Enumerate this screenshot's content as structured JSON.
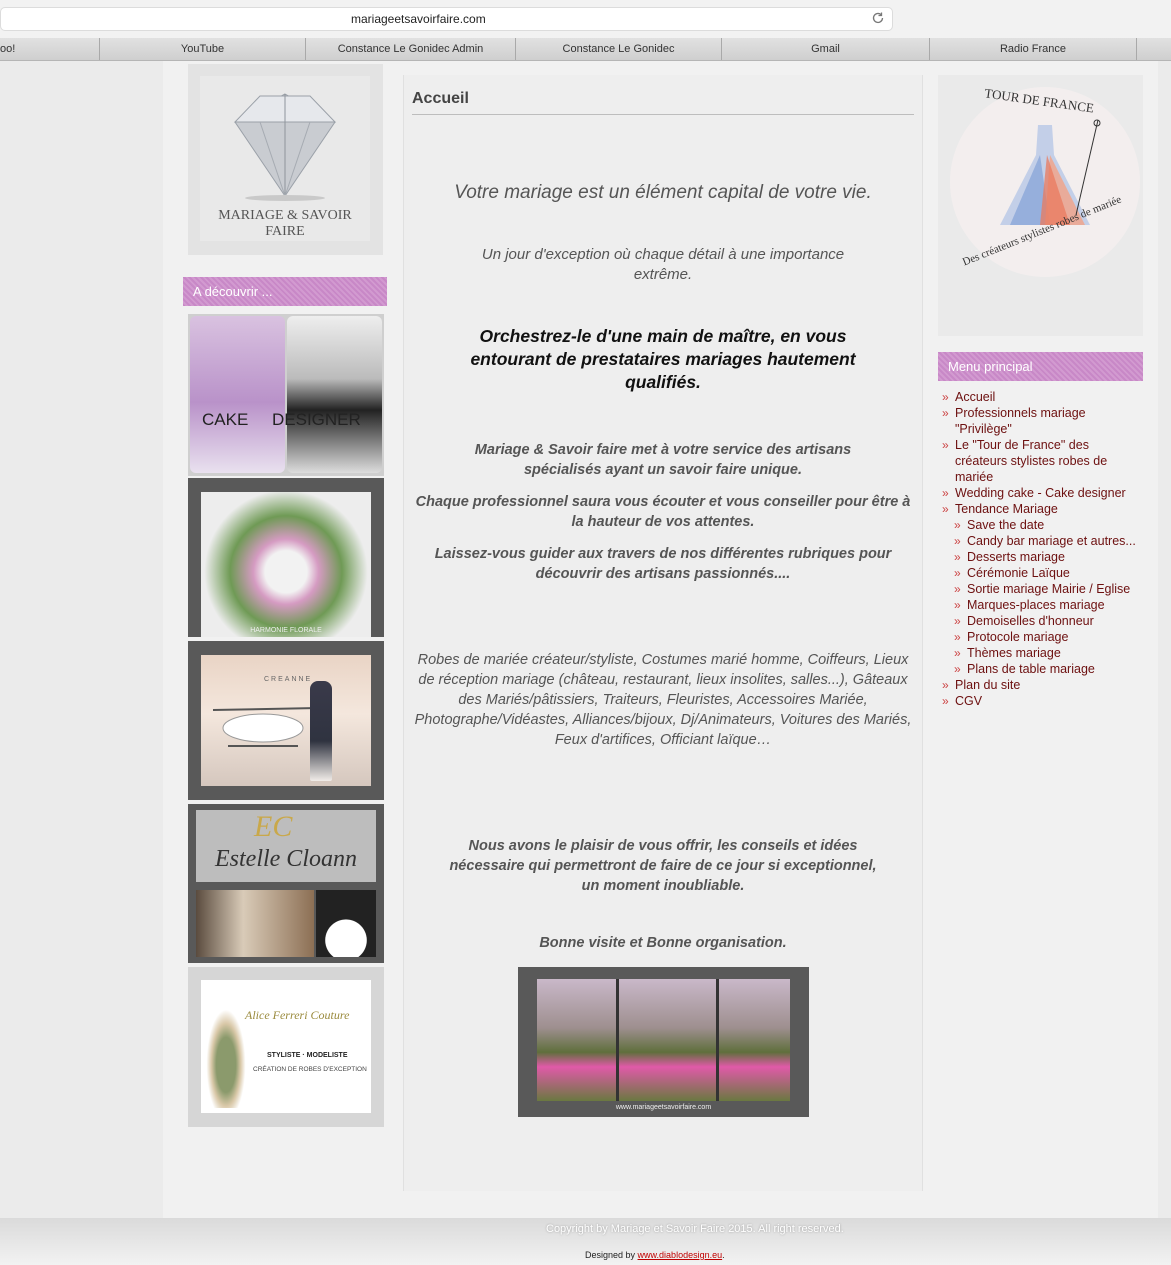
{
  "browser": {
    "url": "mariageetsavoirfaire.com",
    "bookmarks": [
      "oo!",
      "YouTube",
      "Constance Le Gonidec Admin",
      "Constance Le Gonidec",
      "Gmail",
      "Radio France"
    ]
  },
  "logo": {
    "text": "MARIAGE & SAVOIR FAIRE"
  },
  "sidebar_left": {
    "heading": "A découvrir ...",
    "cake_label_1": "CAKE",
    "cake_label_2": "DESIGNER",
    "floral_label": "HARMONIE FLORALE",
    "photo_label": "CREANNE",
    "estelle_monogram": "EC",
    "estelle_name": "Estelle Cloann",
    "alice_name": "Alice Ferreri Couture",
    "alice_sub1": "STYLISTE · MODELISTE",
    "alice_sub2": "CRÉATION DE ROBES D'EXCEPTION"
  },
  "content": {
    "title": "Accueil",
    "p1": "Votre mariage est un élément capital de votre vie.",
    "p2": "Un jour d'exception où chaque détail à une importance extrême.",
    "p3": "Orchestrez-le d'une main de maître, en vous entourant de prestataires mariages hautement qualifiés.",
    "p4": "Mariage & Savoir faire met à votre service des artisans spécialisés ayant un savoir faire unique.",
    "p5": "Chaque professionnel saura vous écouter et vous conseiller pour être à la hauteur de vos attentes.",
    "p6": "Laissez-vous guider aux travers de nos différentes rubriques pour découvrir des artisans passionnés....",
    "p7": "Robes de mariée créateur/styliste, Costumes marié homme, Coiffeurs, Lieux de réception mariage (château, restaurant, lieux insolites, salles...), Gâteaux des Mariés/pâtissiers, Traiteurs, Fleuristes, Accessoires Mariée, Photographe/Vidéastes, Alliances/bijoux, Dj/Animateurs, Voitures des Mariés, Feux d'artifices, Officiant laïque…",
    "p8": "Nous avons le plaisir de vous offrir, les conseils et idées nécessaire qui permettront de faire de ce jour si exceptionnel, un moment inoubliable.",
    "p9": "Bonne visite et Bonne organisation.",
    "banner_url": "www.mariageetsavoirfaire.com"
  },
  "tour_de_france": {
    "title": "TOUR DE FRANCE",
    "subtitle": "Des créateurs stylistes robes de mariée"
  },
  "menu": {
    "heading": "Menu principal",
    "items": [
      {
        "label": "Accueil",
        "sub": false
      },
      {
        "label": "Professionnels mariage \"Privilège\"",
        "sub": false
      },
      {
        "label": " Le \"Tour de France\" des créateurs stylistes robes de mariée",
        "sub": false
      },
      {
        "label": "Wedding cake - Cake designer",
        "sub": false
      },
      {
        "label": "Tendance Mariage",
        "sub": false
      },
      {
        "label": "Save the date",
        "sub": true
      },
      {
        "label": "Candy bar mariage et autres...",
        "sub": true
      },
      {
        "label": "Desserts mariage",
        "sub": true
      },
      {
        "label": "Cérémonie Laïque",
        "sub": true
      },
      {
        "label": "Sortie mariage Mairie / Eglise",
        "sub": true
      },
      {
        "label": "Marques-places mariage",
        "sub": true
      },
      {
        "label": "Demoiselles d'honneur",
        "sub": true
      },
      {
        "label": "Protocole mariage",
        "sub": true
      },
      {
        "label": "Thèmes mariage",
        "sub": true
      },
      {
        "label": "Plans de table mariage",
        "sub": true
      },
      {
        "label": "Plan du site",
        "sub": false
      },
      {
        "label": "CGV",
        "sub": false
      }
    ]
  },
  "footer": {
    "copyright": "Copyright by Mariage et Savoir Faire 2015. All right reserved.",
    "designed_by": "Designed by ",
    "designer_link": "www.diablodesign.eu",
    "designer_suffix": "."
  },
  "colors": {
    "accent_pink": "#c888c7",
    "menu_text": "#6d1010",
    "link_red": "#c00000"
  }
}
